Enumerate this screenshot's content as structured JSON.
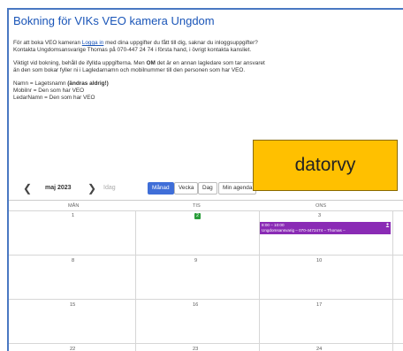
{
  "page": {
    "title": "Bokning för VIKs VEO kamera Ungdom",
    "intro": {
      "p1_pre": "För att boka VEO kameran ",
      "p1_link": "Logga in",
      "p1_post": " med dina uppgifter du fått till dig, saknar du inloggsuppgifter?",
      "p1_line2": "Kontakta Ungdomsansvarige Thomas på  070-447 24 74 i första hand, i övrigt kontakta kansliet.",
      "p2_pre": "Viktigt vid bokning, behåll de ifyllda uppgifterna. Men ",
      "p2_bold": "OM",
      "p2_post": " det är en annan lagledare som tar ansvaret",
      "p2_line2": "än den som bokar fyller ni i Lagledarnamn och mobilnummer till den personen som har VEO.",
      "p3_line1_pre": "Namn = Lagetsnamn ",
      "p3_line1_bold": "(ändras aldrig!)",
      "p3_line2": "Mobilnr = Den som har VEO",
      "p3_line3": "LedarNamn = Den som har VEO"
    }
  },
  "overlay_label": "datorvy",
  "toolbar": {
    "prev_label": "❮",
    "next_label": "❯",
    "month": "maj 2023",
    "today": "Idag",
    "view_month": "Månad",
    "view_week": "Vecka",
    "view_day": "Dag",
    "view_agenda": "Min agenda"
  },
  "calendar": {
    "weekdays": [
      "MÅN",
      "TIS",
      "ONS"
    ],
    "weeks": [
      [
        "1",
        "2",
        "3"
      ],
      [
        "8",
        "9",
        "10"
      ],
      [
        "15",
        "16",
        "17"
      ],
      [
        "22",
        "23",
        "24"
      ]
    ],
    "event": {
      "time": "8:00 – 10:00",
      "text": "Ungdomsansvarig – 070-4472474 – Thomas –",
      "color": "#8a2bb5"
    }
  }
}
